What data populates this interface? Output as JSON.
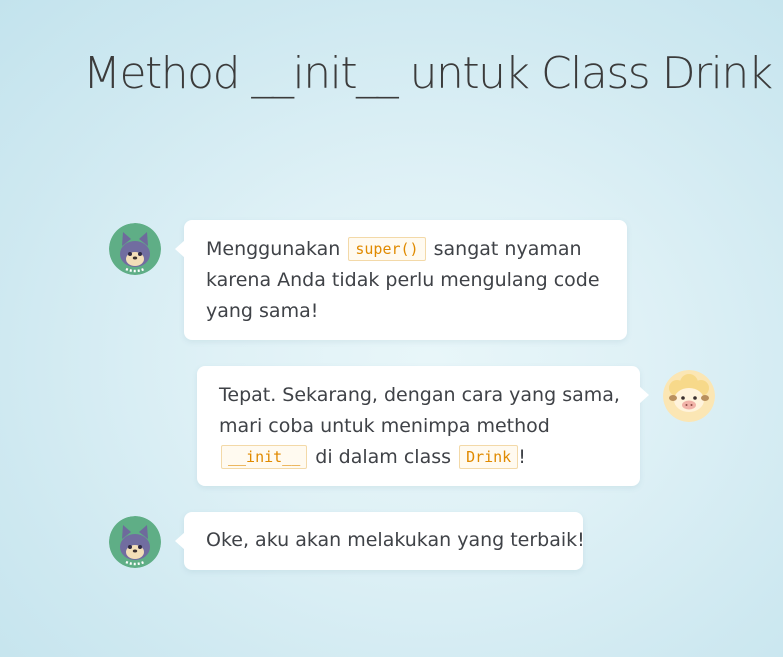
{
  "page": {
    "title": "Method __init__ untuk Class Drink"
  },
  "characters": {
    "left_avatar": "cat-avatar-icon",
    "right_avatar": "sheep-avatar-icon"
  },
  "messages": [
    {
      "speaker": "cat",
      "side": "left",
      "parts": {
        "t1": "Menggunakan",
        "code1": "super()",
        "t2": "sangat nyaman",
        "t3": "karena Anda tidak perlu mengulang code",
        "t4": "yang sama!"
      }
    },
    {
      "speaker": "sheep",
      "side": "right",
      "parts": {
        "t1": "Tepat. Sekarang, dengan cara yang sama,",
        "t2": "mari coba untuk menimpa method",
        "code1": "__init__",
        "t3": "di dalam class",
        "code2": "Drink",
        "t4": "!"
      }
    },
    {
      "speaker": "cat",
      "side": "left",
      "parts": {
        "t1": "Oke, aku akan melakukan yang terbaik!"
      }
    }
  ],
  "colors": {
    "code_text": "#e08a00",
    "code_border": "#f3d9a8",
    "title_text": "#3b3b3b",
    "body_text": "#3f4247",
    "cat_avatar_bg": "#5fae86",
    "sheep_avatar_bg": "#f7d98a"
  }
}
